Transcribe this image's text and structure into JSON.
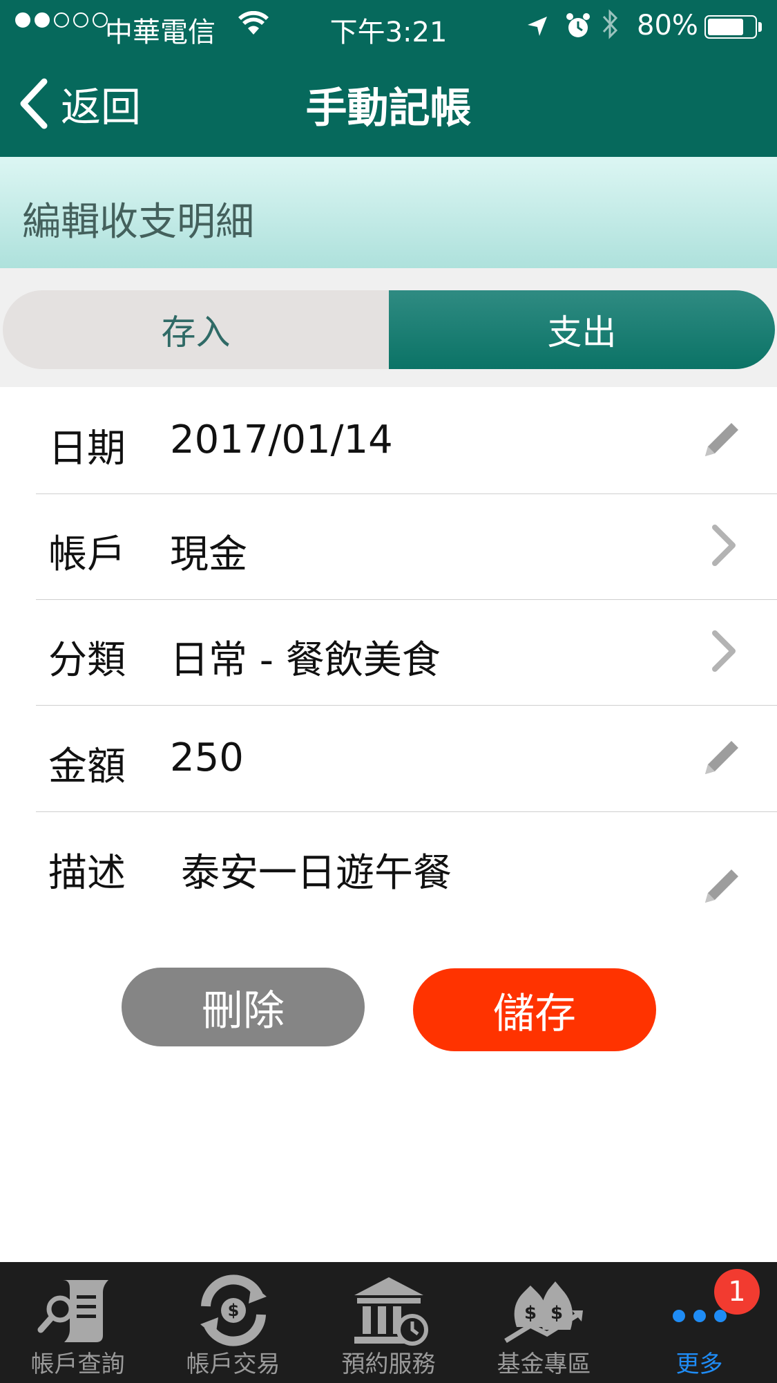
{
  "status_bar": {
    "carrier": "中華電信",
    "time": "下午3:21",
    "battery": "80%",
    "battery_level": 0.8
  },
  "nav": {
    "back_label": "返回",
    "title": "手動記帳"
  },
  "section": {
    "title": "編輯收支明細"
  },
  "segment": {
    "options": [
      "存入",
      "支出"
    ],
    "selected": "支出"
  },
  "form": {
    "date": {
      "label": "日期",
      "value": "2017/01/14",
      "action_icon": "pencil-icon"
    },
    "account": {
      "label": "帳戶",
      "value": "現金",
      "action_icon": "chevron-right-icon"
    },
    "category": {
      "label": "分類",
      "value": "日常 - 餐飲美食",
      "action_icon": "chevron-right-icon"
    },
    "amount": {
      "label": "金額",
      "value": "250",
      "action_icon": "pencil-icon"
    },
    "description": {
      "label": "描述",
      "value": "泰安一日遊午餐",
      "action_icon": "pencil-icon"
    }
  },
  "buttons": {
    "delete_label": "刪除",
    "save_label": "儲存"
  },
  "tabbar": {
    "items": [
      {
        "label": "帳戶查詢",
        "icon": "scroll-search-icon"
      },
      {
        "label": "帳戶交易",
        "icon": "money-exchange-icon"
      },
      {
        "label": "預約服務",
        "icon": "bank-clock-icon"
      },
      {
        "label": "基金專區",
        "icon": "money-bags-chart-icon"
      },
      {
        "label": "更多",
        "icon": "more-dots-icon"
      }
    ],
    "active_index": 4,
    "badge": "1"
  },
  "colors": {
    "header": "#06695c",
    "active_tab": "#1f8cf5",
    "save_button": "#ff3300",
    "delete_button": "#858585"
  }
}
